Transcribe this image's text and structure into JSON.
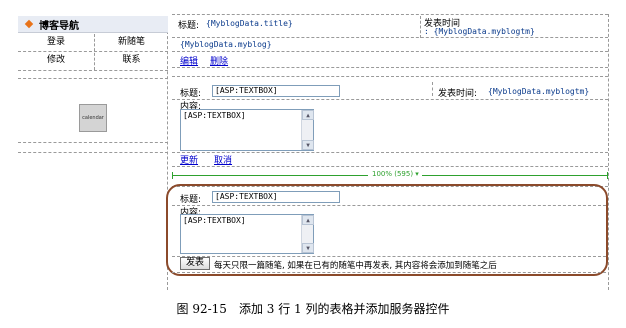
{
  "nav": {
    "header_title": "博客导航",
    "items": [
      {
        "label": "登录"
      },
      {
        "label": "新随笔"
      },
      {
        "label": "修改"
      },
      {
        "label": "联系"
      }
    ],
    "calendar_label": "calendar"
  },
  "display": {
    "title_label": "标题:",
    "title_binding": "{MyblogData.title}",
    "time_label": "发表时间",
    "time_binding": ": {MyblogData.myblogtm}",
    "body_binding": "{MyblogData.myblog}",
    "edit_link": "编辑",
    "delete_link": "删除"
  },
  "edit_form": {
    "title_label": "标题:",
    "title_box": "[ASP:TEXTBOX]",
    "time_label": "发表时间:",
    "time_binding": "{MyblogData.myblogtm}",
    "content_label": "内容:",
    "content_box": "[ASP:TEXTBOX]",
    "update_link": "更新",
    "cancel_link": "取消"
  },
  "ruler": {
    "text": "100% (595)"
  },
  "new_form": {
    "title_label": "标题:",
    "title_box": "[ASP:TEXTBOX]",
    "content_label": "内容:",
    "content_box": "[ASP:TEXTBOX]",
    "submit_button": "发表",
    "notice": "每天只限一篇随笔, 如果在已有的随笔中再发表, 其内容将会添加到随笔之后"
  },
  "caption": "图 92-15　添加 3 行 1 列的表格并添加服务器控件",
  "colors": {
    "nav_header_bg": "#e8ecf4",
    "nav_diamond": "#e8731a",
    "ruler_green": "#2ea12e",
    "highlight_border": "#8b4a2b",
    "binding_text": "#0b3b8c"
  }
}
